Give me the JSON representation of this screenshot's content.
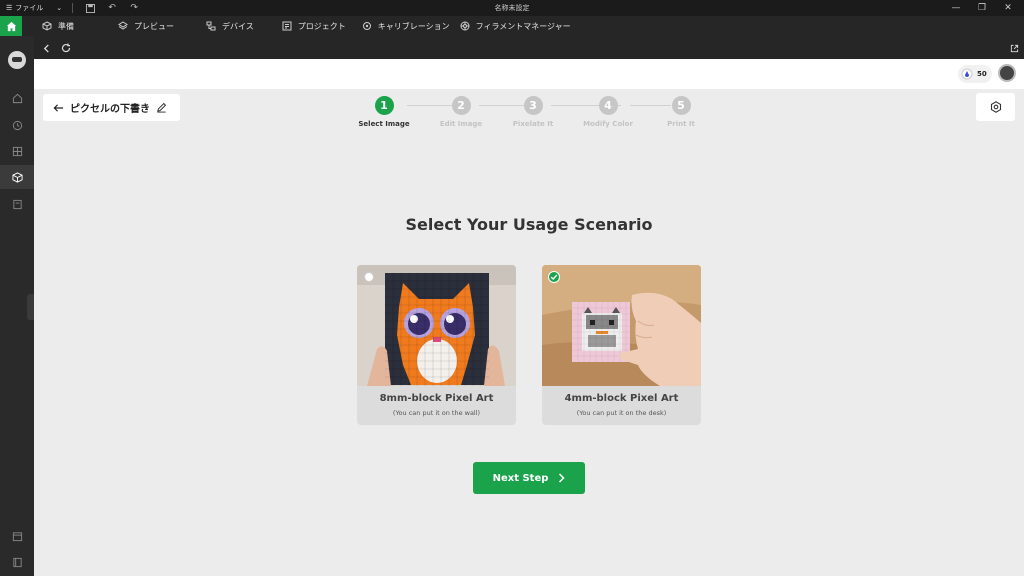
{
  "titlebar": {
    "menu_label": "ファイル",
    "window_title": "名称未設定"
  },
  "toolbar": {
    "items": [
      {
        "label": "準備",
        "icon": "cube-icon"
      },
      {
        "label": "プレビュー",
        "icon": "layers-icon"
      },
      {
        "label": "デバイス",
        "icon": "device-icon"
      },
      {
        "label": "プロジェクト",
        "icon": "project-icon"
      },
      {
        "label": "キャリブレーション",
        "icon": "calibration-icon"
      },
      {
        "label": "フィラメントマネージャー",
        "icon": "filament-icon"
      }
    ]
  },
  "header": {
    "coin_count": "50"
  },
  "main": {
    "back_label": "ピクセルの下書き",
    "steps": [
      {
        "number": "1",
        "label": "Select Image",
        "active": true
      },
      {
        "number": "2",
        "label": "Edit Image",
        "active": false
      },
      {
        "number": "3",
        "label": "Pixelate It",
        "active": false
      },
      {
        "number": "4",
        "label": "Modify Color",
        "active": false
      },
      {
        "number": "5",
        "label": "Print It",
        "active": false
      }
    ],
    "heading": "Select Your Usage Scenario",
    "cards": [
      {
        "title": "8mm-block Pixel Art",
        "subtitle": "(You can put it on the wall)",
        "selected": false
      },
      {
        "title": "4mm-block Pixel Art",
        "subtitle": "(You can put it on the desk)",
        "selected": true
      }
    ],
    "next_label": "Next Step"
  },
  "colors": {
    "accent": "#1aa34a",
    "sidebar": "#2a2a2a",
    "toolbar": "#262626",
    "background": "#ececec"
  }
}
